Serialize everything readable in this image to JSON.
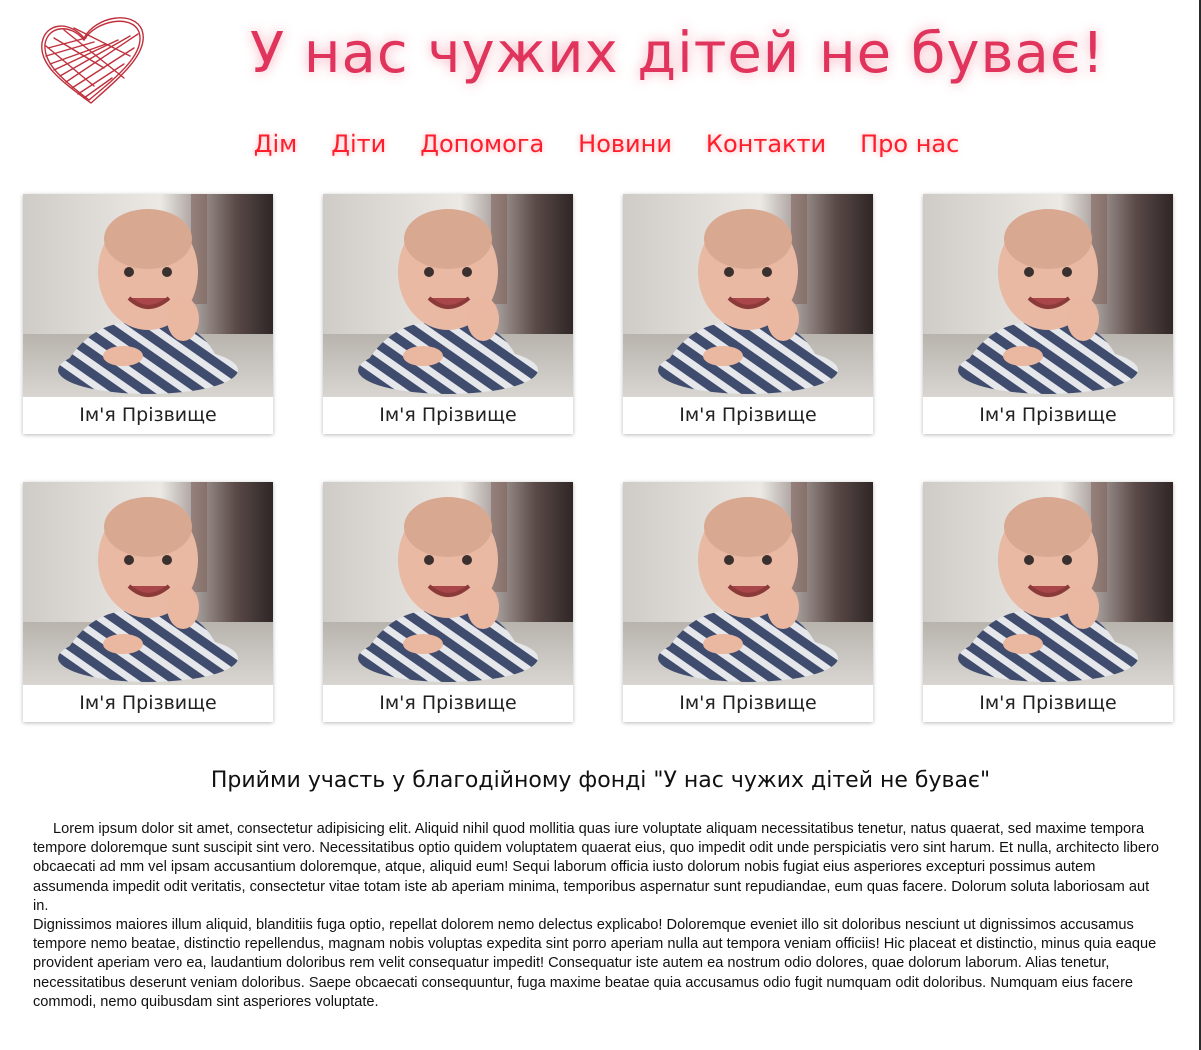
{
  "header": {
    "title": "У нас чужих дітей не буває!",
    "logo_icon": "heart-scribble-icon",
    "accent_color": "#e0345c"
  },
  "nav": {
    "items": [
      {
        "label": "Дім"
      },
      {
        "label": "Діти"
      },
      {
        "label": "Допомога"
      },
      {
        "label": "Новини"
      },
      {
        "label": "Контакти"
      },
      {
        "label": "Про нас"
      }
    ],
    "color": "#ff1e2d"
  },
  "children": {
    "cards": [
      {
        "name": "Ім'я Прізвище"
      },
      {
        "name": "Ім'я Прізвище"
      },
      {
        "name": "Ім'я Прізвище"
      },
      {
        "name": "Ім'я Прізвище"
      },
      {
        "name": "Ім'я Прізвище"
      },
      {
        "name": "Ім'я Прізвище"
      },
      {
        "name": "Ім'я Прізвище"
      },
      {
        "name": "Ім'я Прізвище"
      }
    ]
  },
  "section": {
    "heading": "Прийми участь у благодійному фонді \"У нас чужих дітей не буває\"",
    "paragraph1": "Lorem ipsum dolor sit amet, consectetur adipisicing elit. Aliquid nihil quod mollitia quas iure voluptate aliquam necessitatibus tenetur, natus quaerat, sed maxime tempora tempore doloremque sunt suscipit sint vero. Necessitatibus optio quidem voluptatem quaerat eius, quo impedit odit unde perspiciatis vero sint harum. Et nulla, architecto libero obcaecati ad mm vel ipsam accusantium doloremque, atque, aliquid eum! Sequi laborum officia iusto dolorum nobis fugiat eius asperiores excepturi possimus autem assumenda impedit odit veritatis, consectetur vitae totam iste ab aperiam minima, temporibus aspernatur sunt repudiandae, eum quas facere. Dolorum soluta laboriosam aut in.",
    "paragraph2": "Dignissimos maiores illum aliquid, blanditiis fuga optio, repellat dolorem nemo delectus explicabo! Doloremque eveniet illo sit doloribus nesciunt ut dignissimos accusamus tempore nemo beatae, distinctio repellendus, magnam nobis voluptas expedita sint porro aperiam nulla aut tempora veniam officiis! Hic placeat et distinctio, minus quia eaque provident aperiam vero ea, laudantium doloribus rem velit consequatur impedit! Consequatur iste autem ea nostrum odio dolores, quae dolorum laborum. Alias tenetur, necessitatibus deserunt veniam doloribus. Saepe obcaecati consequuntur, fuga maxime beatae quia accusamus odio fugit numquam odit doloribus. Numquam eius facere commodi, nemo quibusdam sint asperiores voluptate."
  }
}
